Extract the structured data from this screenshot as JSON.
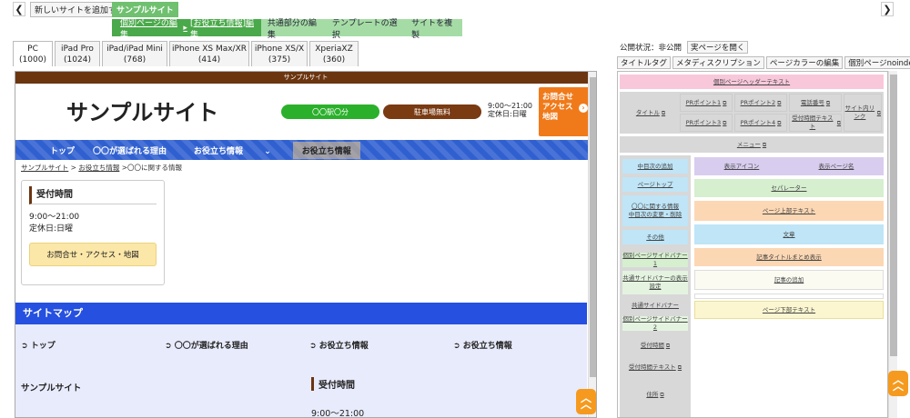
{
  "toolbar": {
    "add_site": "新しいサイトを追加する",
    "site_name": "サンプルサイト"
  },
  "subnav": {
    "edit_page": "個別ページの編集",
    "page_label": "[お役立ち情報]編集",
    "common": "共通部分の編集",
    "template": "テンプレートの選択",
    "copy": "サイトを複製"
  },
  "devices": [
    {
      "name": "PC",
      "size": "(1000)"
    },
    {
      "name": "iPad Pro",
      "size": "(1024)"
    },
    {
      "name": "iPad/iPad Mini",
      "size": "(768)"
    },
    {
      "name": "iPhone XS Max/XR",
      "size": "(414)"
    },
    {
      "name": "iPhone XS/X",
      "size": "(375)"
    },
    {
      "name": "XperiaXZ",
      "size": "(360)"
    }
  ],
  "site": {
    "bar": "サンプルサイト",
    "title": "サンプルサイト",
    "station": "〇〇駅〇分",
    "parking": "駐車場無料",
    "hours": "9:00〜21:00",
    "closed": "定休日:日曜",
    "contact_btn": [
      "お問合せ",
      "アクセス",
      "地図"
    ],
    "nav": [
      "トップ",
      "〇〇が選ばれる理由",
      "お役立ち情報",
      "お役立ち情報"
    ],
    "breadcrumb": {
      "home": "サンプルサイト",
      "sep": " > ",
      "parent": "お役立ち情報",
      "current": " >〇〇に関する情報"
    },
    "box": {
      "heading": "受付時間",
      "hours": "9:00〜21:00",
      "closed": "定休日:日曜",
      "button": "お問合せ・アクセス・地図"
    },
    "sitemap": {
      "heading": "サイトマップ",
      "links": [
        "トップ",
        "〇〇が選ばれる理由",
        "お役立ち情報",
        "お役立ち情報"
      ],
      "footer_name": "サンプルサイト",
      "footer_heading": "受付時間",
      "footer_hours": "9:00〜21:00"
    }
  },
  "panel": {
    "status": "公開状況：非公開",
    "open": "実ページを開く",
    "tabs": [
      "タイトルタグ",
      "メタディスクリプション",
      "ページカラーの編集",
      "個別ページnoindex"
    ],
    "header_text": "個別ページヘッダーテキスト",
    "title": "タイトル",
    "pr1": "PRポイント1",
    "pr2": "PRポイント2",
    "pr3": "PRポイント3",
    "pr4": "PRポイント4",
    "tel": "電話番号",
    "hours": "受付時間テキスト",
    "site_link": "サイト内リンク",
    "menu": "メニュー",
    "left": [
      "中目次の追加",
      "ページトップ",
      "〇〇に関する情報",
      "中目次の変更・削除",
      "その他",
      "個別ページサイドバナー1",
      "共通サイドバナーの表示設定",
      "共通サイドバナー",
      "個別ページサイドバナー2",
      "受付時間",
      "受付時間テキスト",
      "住所"
    ],
    "main": {
      "icon": "表示アイコン",
      "page_name": "表示ページ名",
      "separator": "セパレーター",
      "top_text": "ページ上部テキスト",
      "body": "文章",
      "summary": "記事タイトルまとめ表示",
      "add": "記事の追加",
      "bottom_text": "ページ下部テキスト"
    }
  },
  "colors": {
    "brown": "#6b3510",
    "blue": "#3060d0",
    "green": "#2bb02b",
    "orange": "#f07a1a"
  }
}
